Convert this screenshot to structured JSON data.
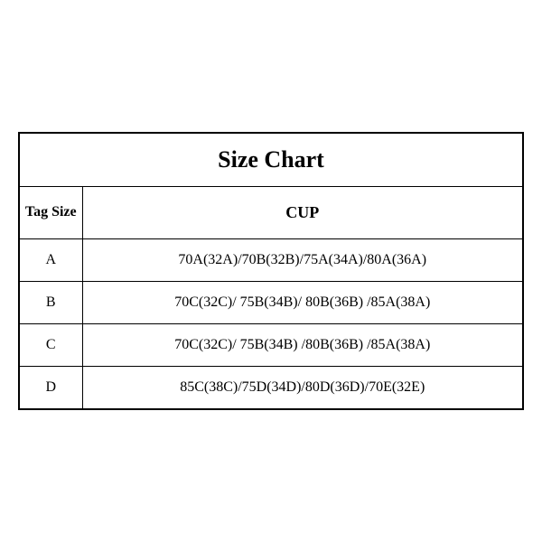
{
  "title": "Size Chart",
  "headers": {
    "tag_size": "Tag Size",
    "cup": "CUP"
  },
  "rows": [
    {
      "tag": "A",
      "cup": "70A(32A)/70B(32B)/75A(34A)/80A(36A)"
    },
    {
      "tag": "B",
      "cup": "70C(32C)/ 75B(34B)/ 80B(36B) /85A(38A)"
    },
    {
      "tag": "C",
      "cup": "70C(32C)/ 75B(34B) /80B(36B) /85A(38A)"
    },
    {
      "tag": "D",
      "cup": "85C(38C)/75D(34D)/80D(36D)/70E(32E)"
    }
  ]
}
